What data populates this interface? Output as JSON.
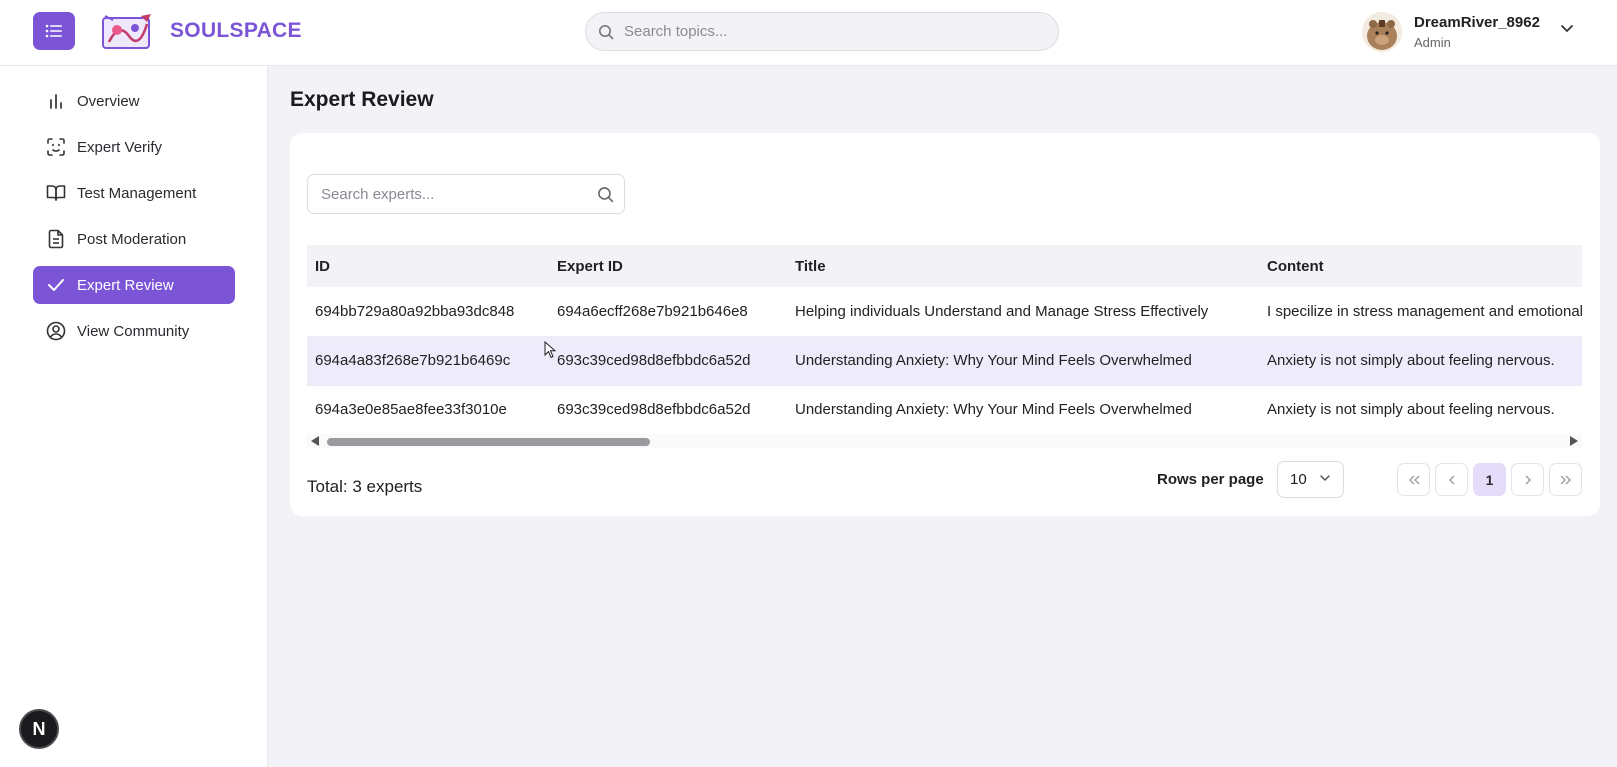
{
  "header": {
    "brand": "SOULSPACE",
    "search_placeholder": "Search topics...",
    "user": {
      "name": "DreamRiver_8962",
      "role": "Admin"
    }
  },
  "sidebar": {
    "items": [
      {
        "label": "Overview",
        "icon": "bar-chart-icon",
        "active": false
      },
      {
        "label": "Expert Verify",
        "icon": "scan-face-icon",
        "active": false
      },
      {
        "label": "Test Management",
        "icon": "open-book-icon",
        "active": false
      },
      {
        "label": "Post Moderation",
        "icon": "document-icon",
        "active": false
      },
      {
        "label": "Expert Review",
        "icon": "check-icon",
        "active": true
      },
      {
        "label": "View Community",
        "icon": "user-circle-icon",
        "active": false
      }
    ],
    "fab_label": "N"
  },
  "main": {
    "title": "Expert Review",
    "search_placeholder": "Search experts...",
    "table": {
      "columns": [
        "ID",
        "Expert ID",
        "Title",
        "Content"
      ],
      "rows": [
        [
          "694bb729a80a92bba93dc848",
          "694a6ecff268e7b921b646e8",
          "Helping individuals Understand and Manage Stress Effectively",
          "I specilize in stress management and emotional"
        ],
        [
          "694a4a83f268e7b921b6469c",
          "693c39ced98d8efbbdc6a52d",
          "Understanding Anxiety: Why Your Mind Feels Overwhelmed",
          "Anxiety is not simply about feeling nervous."
        ],
        [
          "694a3e0e85ae8fee33f3010e",
          "693c39ced98d8efbbdc6a52d",
          "Understanding Anxiety: Why Your Mind Feels Overwhelmed",
          "Anxiety is not simply about feeling nervous."
        ]
      ]
    },
    "total_text": "Total: 3 experts",
    "rows_per_page_label": "Rows per page",
    "rows_per_page_value": "10",
    "current_page": "1"
  },
  "colors": {
    "accent": "#7b55d6",
    "row_highlight": "#eeebfa",
    "page_bg": "#f3f3f7"
  }
}
